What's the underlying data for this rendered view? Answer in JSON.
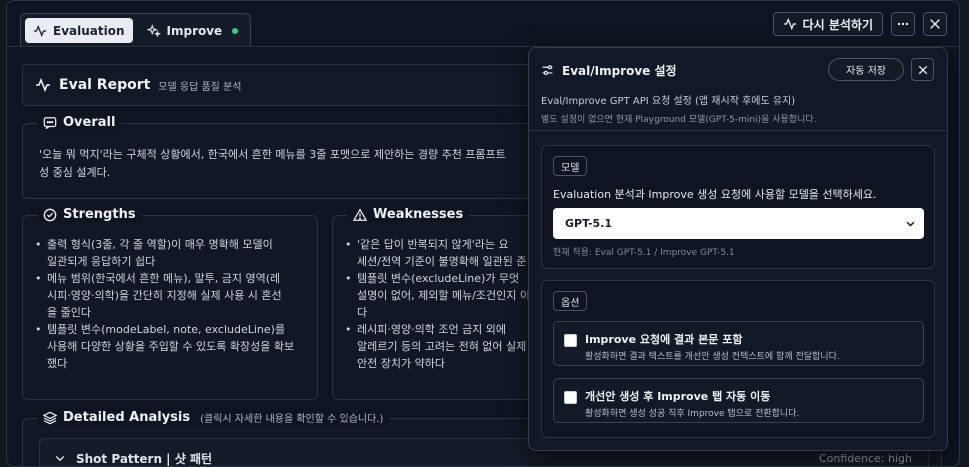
{
  "tabs": [
    {
      "label": "Evaluation",
      "active": true
    },
    {
      "label": "Improve",
      "active": false,
      "status_color": "#2fd08a"
    }
  ],
  "actions": {
    "reanalyze_label": "다시 분석하기"
  },
  "report": {
    "title": "Eval Report",
    "subtitle": "모델 응답 품질 분석"
  },
  "overall": {
    "heading": "Overall",
    "line1": "'오늘 뭐 먹지'라는 구체적 상황에서, 한국에서 흔한 메뉴를 3줄 포맷으로 제안하는 경량 추천 프롬프트",
    "line2": "성 중심 설계다."
  },
  "strengths": {
    "heading": "Strengths",
    "items": [
      {
        "l1": "출력 형식(3줄, 각 줄 역할)이 매우 명확해 모델이",
        "l2": "일관되게 응답하기 쉽다"
      },
      {
        "l1": "메뉴 범위(한국에서 흔한 메뉴), 말투, 금지 영역(레",
        "l2": "시피·영양·의학)을 간단히 지정해 실제 사용 시 혼선",
        "l3": "을 줄인다"
      },
      {
        "l1": "템플릿 변수(modeLabel, note, excludeLine)를",
        "l2": "사용해 다양한 상황을 주입할 수 있도록 확장성을 확보",
        "l3": "했다"
      }
    ]
  },
  "weaknesses": {
    "heading": "Weaknesses",
    "items": [
      {
        "l1": "'같은 답이 반복되지 않게'라는 요",
        "l2": "세션/전역 기준이 불명확해 일관된 준"
      },
      {
        "l1": "템플릿 변수(excludeLine)가 무엇",
        "l2": "설명이 없어, 제외할 메뉴/조건인지 이",
        "l3": "다"
      },
      {
        "l1": "레시피·영양·의학 조언 금지 외에",
        "l2": "알레르기 등의 고려는 전혀 없어 실제",
        "l3": "안전 장치가 약하다"
      }
    ]
  },
  "detailed": {
    "heading": "Detailed Analysis",
    "hint": "(클릭시 자세한 내용을 확인할 수 있습니다.)",
    "shot_title": "Shot Pattern | 샷 패턴",
    "confidence": "Confidence: high"
  },
  "settings": {
    "title": "Eval/Improve 설정",
    "autosave_label": "자동 저장",
    "desc": "Eval/Improve GPT API 요청 설정 (앱 재시작 후에도 유지)",
    "note": "별도 설정이 없으면 현재 Playground 모델(GPT-5-mini)을 사용합니다.",
    "model_section": {
      "tag": "모델",
      "help": "Evaluation 분석과 Improve 생성 요청에 사용할 모델을 선택하세요.",
      "selected": "GPT-5.1",
      "applied": "현재 적용: Eval GPT-5.1 / Improve GPT-5.1"
    },
    "options_section": {
      "tag": "옵션",
      "options": [
        {
          "title": "Improve 요청에 결과 본문 포함",
          "desc": "활성화하면 결과 텍스트를 개선안 생성 컨텍스트에 함께 전달합니다.",
          "checked": false
        },
        {
          "title": "개선안 생성 후 Improve 탭 자동 이동",
          "desc": "활성화하면 생성 성공 직후 Improve 탭으로 전환합니다.",
          "checked": false
        }
      ]
    }
  }
}
